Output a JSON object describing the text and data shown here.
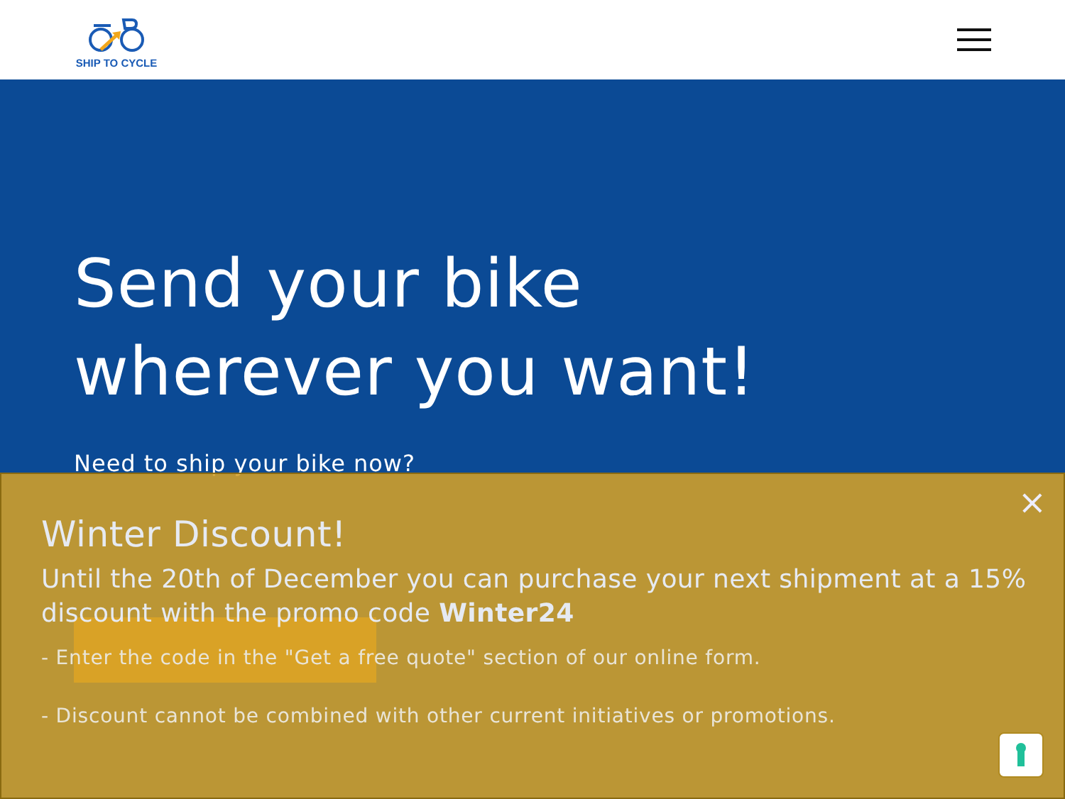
{
  "header": {
    "logo_text": "SHIP TO CYCLE"
  },
  "hero": {
    "title_lines": [
      "Send your bike",
      "wherever you want!"
    ],
    "lines": [
      "Need to ship your bike now?"
    ]
  },
  "banner": {
    "title": "Winter Discount!",
    "subtitle": "Until the 20th of December you can purchase your next shipment at a 15% discount with the promo code **Winter24**",
    "notes": [
      "- Enter the code in the \"Get a free quote\" section of our online form.",
      "- Discount cannot be combined with other current initiatives or promotions."
    ],
    "close": "×"
  }
}
